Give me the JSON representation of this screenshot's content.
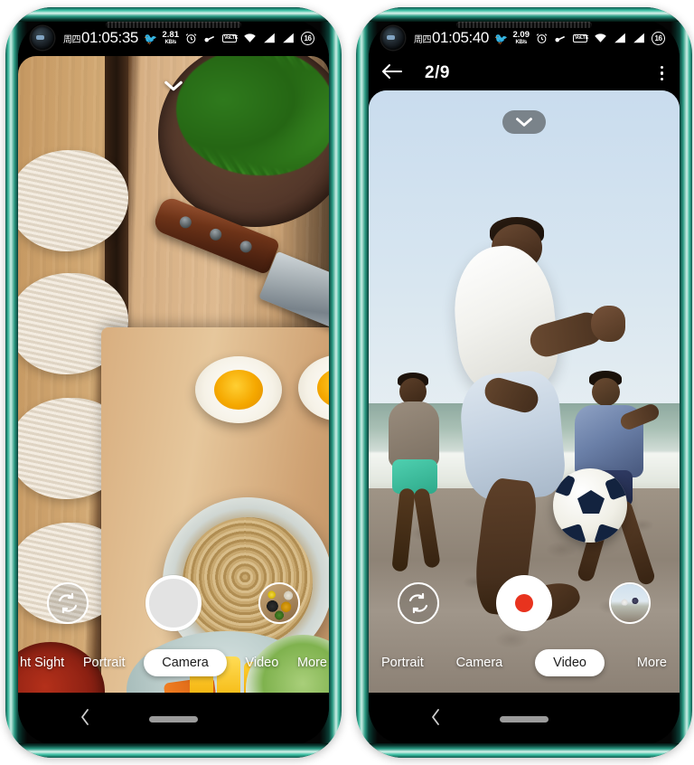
{
  "left_phone": {
    "status_bar": {
      "day": "周四",
      "clock": "01:05:35",
      "bird_icon": "bird-icon",
      "net_speed_value": "2.81",
      "net_speed_unit": "KB/s",
      "alarm_icon": "alarm-clock-icon",
      "key_icon": "key-icon",
      "volte_label": "VoLTE",
      "wifi_icon": "wifi-icon",
      "signal1_icon": "signal-bars-icon",
      "signal2_icon": "signal-bars-icon",
      "battery_level": "16"
    },
    "viewfinder": {
      "scene": "food-on-wooden-board",
      "expand_icon": "chevron-down-icon"
    },
    "controls": {
      "flip_icon": "switch-camera-icon",
      "shutter_label": "shutter-button",
      "thumbnail_label": "gallery-thumbnail-spices"
    },
    "modes": [
      {
        "label": "ht Sight",
        "active": false
      },
      {
        "label": "Portrait",
        "active": false
      },
      {
        "label": "Camera",
        "active": true
      },
      {
        "label": "Video",
        "active": false
      },
      {
        "label": "More",
        "active": false
      }
    ],
    "navbar": {
      "back_icon": "back-chevron-icon",
      "home_icon": "home-pill-icon"
    }
  },
  "right_phone": {
    "status_bar": {
      "day": "周四",
      "clock": "01:05:40",
      "bird_icon": "bird-icon",
      "net_speed_value": "2.09",
      "net_speed_unit": "KB/s",
      "alarm_icon": "alarm-clock-icon",
      "key_icon": "key-icon",
      "volte_label": "VoLTE",
      "wifi_icon": "wifi-icon",
      "signal1_icon": "signal-bars-icon",
      "signal2_icon": "signal-bars-icon",
      "battery_level": "16"
    },
    "app_header": {
      "back_icon": "arrow-left-icon",
      "title": "2/9",
      "overflow_icon": "more-vertical-icon"
    },
    "viewfinder": {
      "scene": "beach-soccer-players",
      "expand_icon": "chevron-down-icon"
    },
    "controls": {
      "flip_icon": "switch-camera-icon",
      "record_label": "record-button",
      "thumbnail_label": "gallery-thumbnail-beach"
    },
    "modes": [
      {
        "label": "Portrait",
        "active": false
      },
      {
        "label": "Camera",
        "active": false
      },
      {
        "label": "Video",
        "active": true
      },
      {
        "label": "More",
        "active": false
      }
    ],
    "navbar": {
      "back_icon": "back-chevron-icon",
      "home_icon": "home-pill-icon"
    }
  },
  "colors": {
    "frame": "#2a9c85",
    "record_red": "#e8331e",
    "active_pill": "#ffffff"
  }
}
